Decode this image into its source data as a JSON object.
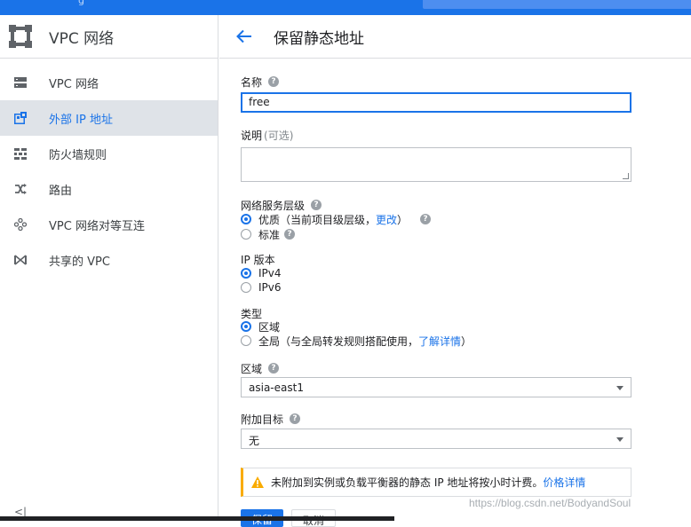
{
  "topbar": {
    "partial_text": "g"
  },
  "sidebar": {
    "title": "VPC 网络",
    "items": [
      {
        "label": "VPC 网络",
        "icon": "vpc-network-icon",
        "active": false
      },
      {
        "label": "外部 IP 地址",
        "icon": "external-ip-icon",
        "active": true
      },
      {
        "label": "防火墙规则",
        "icon": "firewall-icon",
        "active": false
      },
      {
        "label": "路由",
        "icon": "routes-icon",
        "active": false
      },
      {
        "label": "VPC 网络对等互连",
        "icon": "peering-icon",
        "active": false
      },
      {
        "label": "共享的 VPC",
        "icon": "shared-vpc-icon",
        "active": false
      }
    ],
    "collapse_glyph": "<|"
  },
  "header": {
    "title": "保留静态地址",
    "back_icon": "arrow-back-icon"
  },
  "form": {
    "name_label": "名称",
    "name_value": "free",
    "desc_label": "说明",
    "desc_optional": "(可选)",
    "tier_label": "网络服务层级",
    "tier_premium_label": "优质（当前项目级层级，",
    "tier_premium_link": "更改",
    "tier_premium_close": "）",
    "tier_standard_label": "标准",
    "ip_version_label": "IP 版本",
    "ipv4": "IPv4",
    "ipv6": "IPv6",
    "type_label": "类型",
    "type_regional": "区域",
    "type_global": "全局（与全局转发规则搭配使用，",
    "type_global_link": "了解详情",
    "type_global_close": "）",
    "region_label": "区域",
    "region_value": "asia-east1",
    "attach_label": "附加目标",
    "attach_value": "无",
    "notice_text": "未附加到实例或负载平衡器的静态 IP 地址将按小时计费。",
    "notice_link": "价格详情",
    "reserve_button": "保留",
    "cancel_button": "取消"
  },
  "watermark": "https://blog.csdn.net/BodyandSoul",
  "colors": {
    "accent": "#1a73e8",
    "warning": "#f9ab00",
    "active_bg": "#dfe3e8"
  }
}
